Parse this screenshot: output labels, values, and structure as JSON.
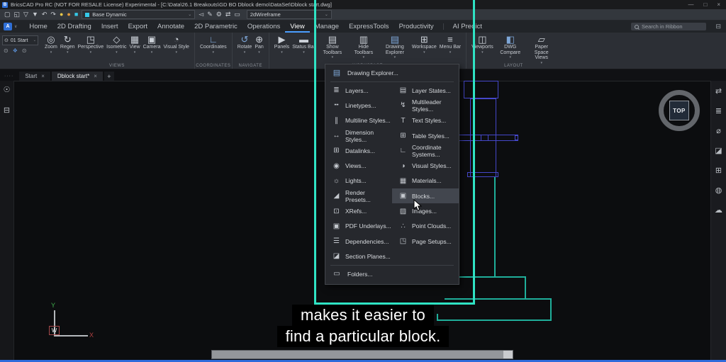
{
  "window": {
    "logo": "B",
    "title": "BricsCAD Pro RC (NOT FOR RESALE License) Experimental - [C:\\Data\\26.1 Breakouts\\GD BO Dblock demo\\DataSet\\Dblock start.dwg]",
    "minimize": "—",
    "maximize": "□",
    "close": "×"
  },
  "qat": {
    "icons": {
      "new": "▢",
      "open": "◱",
      "save": "▽",
      "saveas": "▼",
      "undo": "↶",
      "redo": "↷",
      "dot1": "●",
      "dot2": "●",
      "dot3": "■",
      "pick": "◅",
      "edit": "✎",
      "gear": "⚙",
      "swap": "⇄",
      "monitor": "▭"
    },
    "view_mode": "Base Dynamic",
    "visual_style": "2dWireframe",
    "chevron": "⌄"
  },
  "nav": {
    "app_button": "A",
    "tabs": [
      {
        "label": "Home"
      },
      {
        "label": "2D Drafting"
      },
      {
        "label": "Insert"
      },
      {
        "label": "Export"
      },
      {
        "label": "Annotate"
      },
      {
        "label": "2D Parametric"
      },
      {
        "label": "Operations"
      },
      {
        "label": "View"
      },
      {
        "label": "Manage"
      },
      {
        "label": "ExpressTools"
      },
      {
        "label": "Productivity"
      },
      {
        "label": "AI Predict"
      }
    ],
    "search_placeholder": "Search in Ribbon",
    "ribbon_toggle": "⊟"
  },
  "ribbon": {
    "layer_name": "01 Start",
    "layer_eye": "⊙",
    "eye_icons": [
      "⊙",
      "❖",
      "⊙"
    ],
    "groups": [
      {
        "label": "VIEWS",
        "buttons": [
          {
            "label": "Zoom",
            "icon": "◎"
          },
          {
            "label": "Regen",
            "icon": "↻"
          },
          {
            "label": "Perspective",
            "icon": "◳"
          },
          {
            "label": "Isometric",
            "icon": "◇"
          },
          {
            "label": "View",
            "icon": "▦"
          },
          {
            "label": "Camera",
            "icon": "▣"
          },
          {
            "label": "Visual Style",
            "icon": "◔"
          }
        ]
      },
      {
        "label": "COORDINATES",
        "buttons": [
          {
            "label": "Coordinates",
            "icon": "∟"
          }
        ]
      },
      {
        "label": "NAVIGATE",
        "buttons": [
          {
            "label": "Rotate",
            "icon": "↺"
          },
          {
            "label": "Pan",
            "icon": "⊕"
          }
        ]
      },
      {
        "label": "WORKSPACE",
        "buttons": [
          {
            "label": "Panels",
            "icon": "▶"
          },
          {
            "label": "Status Bar",
            "icon": "▬"
          },
          {
            "label": "Show Toolbars",
            "icon": "▤"
          },
          {
            "label": "Hide Toolbars",
            "icon": "▥"
          },
          {
            "label": "Drawing Explorer",
            "icon": "▤"
          },
          {
            "label": "Workspace",
            "icon": "⊞"
          },
          {
            "label": "Menu Bar",
            "icon": "≡"
          }
        ]
      },
      {
        "label": "LAYOUT",
        "buttons": [
          {
            "label": "Viewports",
            "icon": "◫"
          },
          {
            "label": "DWG Compare",
            "icon": "◧"
          },
          {
            "label": "Paper Space Views",
            "icon": "▱"
          }
        ]
      }
    ]
  },
  "doc_tabs": {
    "tabs": [
      {
        "label": "Start"
      },
      {
        "label": "Dblock start*"
      }
    ],
    "close": "×",
    "add": "+"
  },
  "menu": {
    "header": {
      "label": "Drawing Explorer...",
      "icon": "▤"
    },
    "left": [
      {
        "label": "Layers...",
        "icon": "≣"
      },
      {
        "label": "Linetypes...",
        "icon": "╍"
      },
      {
        "label": "Multiline Styles...",
        "icon": "∥"
      },
      {
        "label": "Dimension Styles...",
        "icon": "↔"
      },
      {
        "label": "Datalinks...",
        "icon": "⊞"
      },
      {
        "label": "Views...",
        "icon": "◉"
      },
      {
        "label": "Lights...",
        "icon": "☼"
      },
      {
        "label": "Render Presets...",
        "icon": "◢"
      },
      {
        "label": "XRefs...",
        "icon": "⊡"
      },
      {
        "label": "PDF Underlays...",
        "icon": "▣"
      },
      {
        "label": "Dependencies...",
        "icon": "☰"
      },
      {
        "label": "Section Planes...",
        "icon": "◪"
      }
    ],
    "right": [
      {
        "label": "Layer States...",
        "icon": "▤"
      },
      {
        "label": "Multileader Styles...",
        "icon": "↯"
      },
      {
        "label": "Text Styles...",
        "icon": "T"
      },
      {
        "label": "Table Styles...",
        "icon": "⊞"
      },
      {
        "label": "Coordinate Systems...",
        "icon": "∟"
      },
      {
        "label": "Visual Styles...",
        "icon": "◑"
      },
      {
        "label": "Materials...",
        "icon": "▦"
      },
      {
        "label": "Blocks...",
        "icon": "▣"
      },
      {
        "label": "Images...",
        "icon": "▨"
      },
      {
        "label": "Point Clouds...",
        "icon": "∴"
      },
      {
        "label": "Page Setups...",
        "icon": "◳"
      }
    ],
    "footer": {
      "label": "Folders...",
      "icon": "▭"
    },
    "highlighted_item": "Blocks..."
  },
  "sidebars": {
    "left_icons": [
      {
        "glyph": "☉"
      },
      {
        "glyph": "⊟"
      }
    ],
    "right_icons": [
      {
        "glyph": "⇄"
      },
      {
        "glyph": "≣"
      },
      {
        "glyph": "⌀"
      },
      {
        "glyph": "◪"
      },
      {
        "glyph": "⊞"
      },
      {
        "glyph": "◍"
      },
      {
        "glyph": "☁"
      }
    ]
  },
  "viewcube": {
    "label": "TOP"
  },
  "ucs": {
    "x_label": "X",
    "y_label": "Y",
    "origin_label": "W"
  },
  "caption": {
    "line1": "makes it easier to",
    "line2": "find a particular block."
  },
  "colors": {
    "highlight_teal": "#2fe3c4",
    "cad_blue": "#4547c9",
    "cad_cyan": "#1fae9a",
    "active_tab_blue": "#4a9eff",
    "caption_bg": "#000000"
  }
}
